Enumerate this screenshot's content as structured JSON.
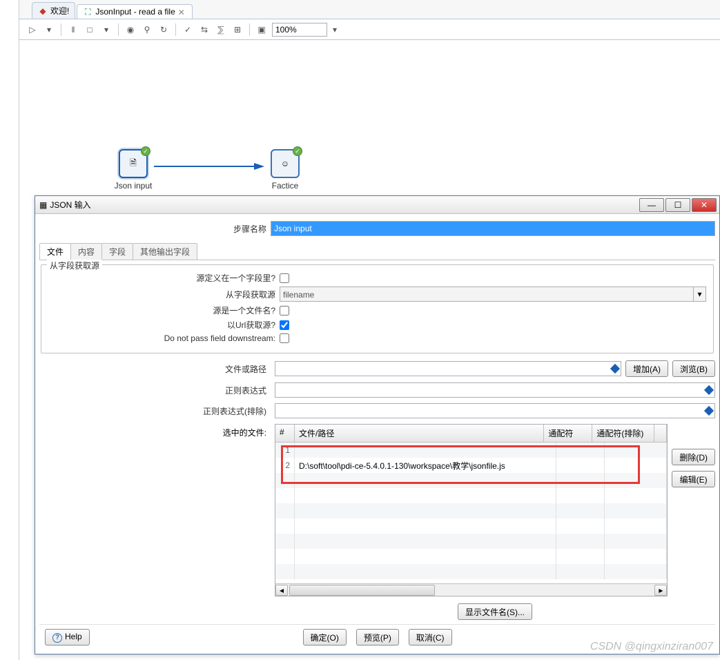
{
  "tabs": {
    "welcome": "欢迎!",
    "current": "JsonInput - read a file"
  },
  "toolbar": {
    "zoom": "100%"
  },
  "canvas": {
    "node1": "Json input",
    "node2": "Factice"
  },
  "dialog": {
    "title": "JSON 输入",
    "step_label": "步骤名称",
    "step_value": "Json input",
    "tabs": {
      "file": "文件",
      "content": "内容",
      "field": "字段",
      "other": "其他输出字段"
    },
    "group_title": "从字段获取源",
    "source_in_field": "源定义在一个字段里?",
    "from_field": "从字段获取源",
    "from_field_value": "filename",
    "source_is_filename": "源是一个文件名?",
    "read_as_url": "以Url获取源?",
    "do_not_pass": "Do not pass field downstream:",
    "file_or_path": "文件或路径",
    "regex": "正则表达式",
    "regex_excl": "正则表达式(排除)",
    "selected_files": "选中的文件:",
    "grid_headers": {
      "num": "#",
      "path": "文件/路径",
      "wild": "通配符",
      "wildex": "通配符(排除)"
    },
    "grid_rows": [
      {
        "num": "1",
        "path": ""
      },
      {
        "num": "2",
        "path": "D:\\soft\\tool\\pdi-ce-5.4.0.1-130\\workspace\\教学\\jsonfile.js"
      }
    ],
    "add_btn": "增加(A)",
    "browse_btn": "浏览(B)",
    "delete_btn": "删除(D)",
    "edit_btn": "编辑(E)",
    "show_filename": "显示文件名(S)...",
    "ok": "确定(O)",
    "preview": "预览(P)",
    "cancel": "取消(C)",
    "help": "Help"
  },
  "watermark": "CSDN @qingxinziran007"
}
